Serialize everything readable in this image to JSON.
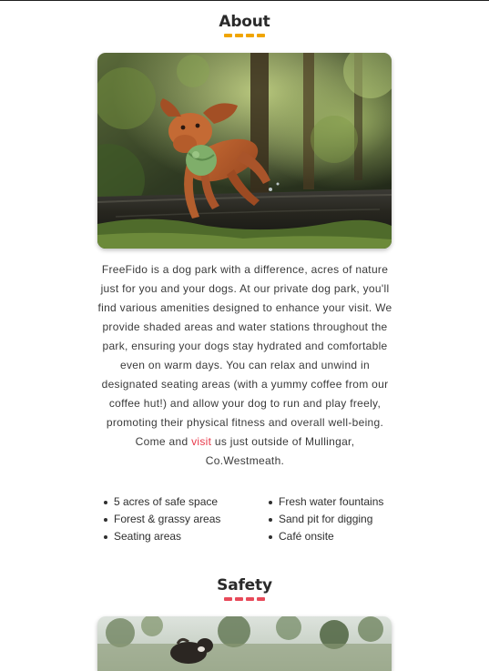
{
  "about": {
    "title": "About",
    "accent_color": "#f0a500",
    "photo_icon": "dog-photo",
    "text_before_link": "FreeFido is a dog park with a difference, acres of nature just for you and your dogs. At our private dog park, you'll find various amenities designed to enhance your visit. We provide shaded areas and water stations throughout the park, ensuring your dogs stay hydrated and comfortable even on warm days. You can relax and unwind in designated seating areas (with a yummy coffee from our coffee hut!) and allow your dog to run and play freely, promoting their physical fitness and overall well-being. Come and ",
    "link_text": "visit",
    "link_color": "#e8394a",
    "text_after_link": " us just outside of Mullingar, Co.Westmeath."
  },
  "amenities": {
    "left": [
      "5 acres of safe space",
      "Forest & grassy areas",
      "Seating areas"
    ],
    "right": [
      "Fresh water fountains",
      "Sand pit for digging",
      "Café onsite"
    ]
  },
  "safety": {
    "title": "Safety",
    "accent_color": "#e84a5a",
    "photo_icon": "dogs-photo"
  }
}
